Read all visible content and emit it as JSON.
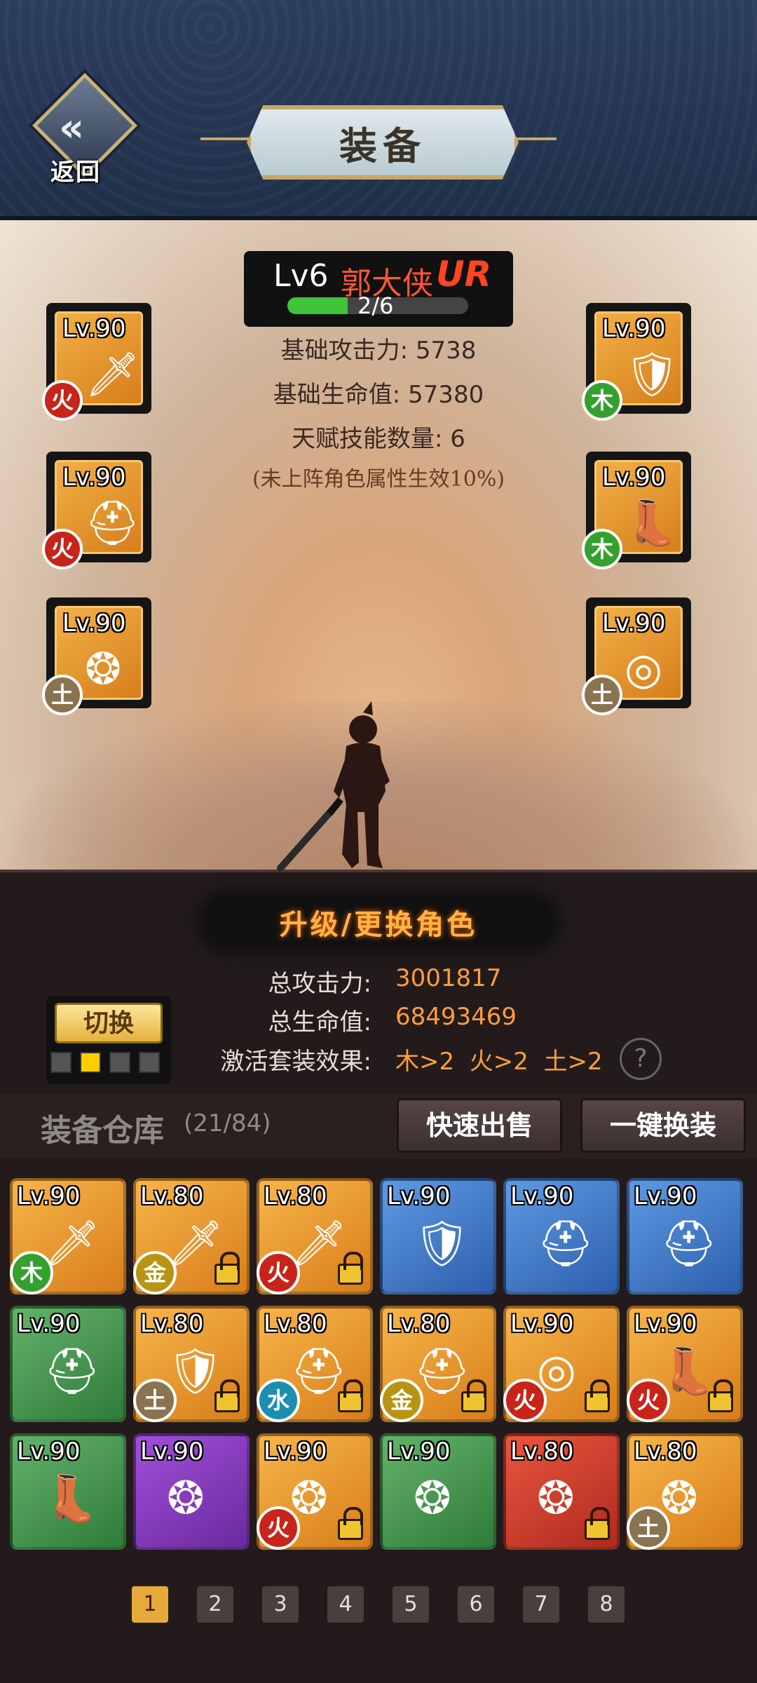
{
  "header": {
    "back_label": "返回",
    "title": "装备"
  },
  "character": {
    "level": "Lv6",
    "name": "郭大侠",
    "rank": "UR",
    "progress_text": "2/6",
    "progress_fraction": 0.333,
    "base_attack": "基础攻击力: 5738",
    "base_hp": "基础生命值: 57380",
    "talent_count": "天赋技能数量: 6",
    "note": "(未上阵角色属性生效10%)"
  },
  "equipped": {
    "left": [
      {
        "level": "Lv.90",
        "element": "火",
        "icon": "sword-icon"
      },
      {
        "level": "Lv.90",
        "element": "火",
        "icon": "helmet-icon"
      },
      {
        "level": "Lv.90",
        "element": "土",
        "icon": "pendant-icon"
      }
    ],
    "right": [
      {
        "level": "Lv.90",
        "element": "木",
        "icon": "armor-icon"
      },
      {
        "level": "Lv.90",
        "element": "木",
        "icon": "boots-icon"
      },
      {
        "level": "Lv.90",
        "element": "土",
        "icon": "belt-icon"
      }
    ]
  },
  "summary": {
    "upgrade_label": "升级/更换角色",
    "total_attack_label": "总攻击力:",
    "total_attack": "3001817",
    "total_hp_label": "总生命值:",
    "total_hp": "68493469",
    "set_label": "激活套装效果:",
    "set_value": "木>2  火>2  土>2",
    "help": "?",
    "switch_label": "切换"
  },
  "warehouse": {
    "title": "装备仓库",
    "count": "(21/84)",
    "quick_sell": "快速出售",
    "one_click_equip": "一键换装",
    "items": [
      {
        "level": "Lv.90",
        "element": "木",
        "color": "orange",
        "icon": "sword-icon",
        "locked": false
      },
      {
        "level": "Lv.80",
        "element": "金",
        "color": "orange",
        "icon": "sword-icon",
        "locked": true
      },
      {
        "level": "Lv.80",
        "element": "火",
        "color": "orange",
        "icon": "sword-icon",
        "locked": true
      },
      {
        "level": "Lv.90",
        "element": "",
        "color": "blue",
        "icon": "armor-icon",
        "locked": false
      },
      {
        "level": "Lv.90",
        "element": "",
        "color": "blue",
        "icon": "helmet-icon",
        "locked": false
      },
      {
        "level": "Lv.90",
        "element": "",
        "color": "blue",
        "icon": "helmet-icon",
        "locked": false
      },
      {
        "level": "Lv.90",
        "element": "",
        "color": "green",
        "icon": "helmet-icon",
        "locked": false
      },
      {
        "level": "Lv.80",
        "element": "土",
        "color": "orange",
        "icon": "armor-icon",
        "locked": true
      },
      {
        "level": "Lv.80",
        "element": "水",
        "color": "orange",
        "icon": "helmet-icon",
        "locked": true
      },
      {
        "level": "Lv.80",
        "element": "金",
        "color": "orange",
        "icon": "helmet-icon",
        "locked": true
      },
      {
        "level": "Lv.90",
        "element": "火",
        "color": "orange",
        "icon": "belt-icon",
        "locked": true
      },
      {
        "level": "Lv.90",
        "element": "火",
        "color": "orange",
        "icon": "boots-icon",
        "locked": true
      },
      {
        "level": "Lv.90",
        "element": "",
        "color": "green",
        "icon": "boots-icon",
        "locked": false
      },
      {
        "level": "Lv.90",
        "element": "",
        "color": "purple",
        "icon": "pendant-icon",
        "locked": false
      },
      {
        "level": "Lv.90",
        "element": "火",
        "color": "orange",
        "icon": "pendant-icon",
        "locked": true
      },
      {
        "level": "Lv.90",
        "element": "",
        "color": "green",
        "icon": "pendant-icon",
        "locked": false
      },
      {
        "level": "Lv.80",
        "element": "",
        "color": "red",
        "icon": "pendant-icon",
        "locked": true
      },
      {
        "level": "Lv.80",
        "element": "土",
        "color": "orange",
        "icon": "pendant-icon",
        "locked": false
      }
    ]
  },
  "pager": {
    "pages": [
      "1",
      "2",
      "3",
      "4",
      "5",
      "6",
      "7",
      "8"
    ],
    "active": "1"
  }
}
